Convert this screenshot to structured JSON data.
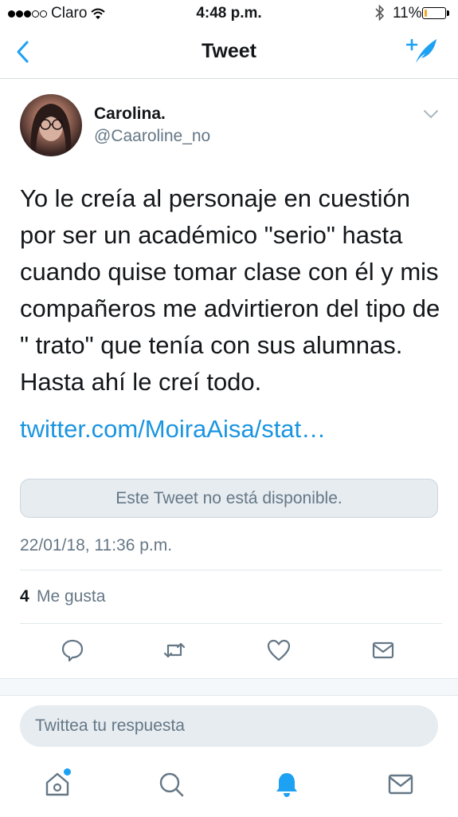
{
  "status_bar": {
    "carrier": "Claro",
    "time": "4:48 p.m.",
    "battery": "11%",
    "battery_level": 0.11,
    "icons": [
      "signal-dots-icon",
      "wifi-icon",
      "bluetooth-icon",
      "battery-icon"
    ]
  },
  "nav": {
    "title": "Tweet",
    "back_icon": "chevron-left-icon",
    "compose_icon": "compose-tweet-icon"
  },
  "tweet": {
    "display_name": "Carolina.",
    "handle": "@Caaroline_no",
    "text": "Yo le creía al personaje en cuestión por ser un académico \"serio\" hasta cuando quise tomar clase con él y mis compañeros me advirtieron del tipo de \" trato\" que tenía con sus alumnas. Hasta ahí le creí todo.",
    "link": "twitter.com/MoiraAisa/stat…",
    "quoted_unavailable": "Este Tweet no está disponible.",
    "timestamp": "22/01/18, 11:36 p.m.",
    "likes_count": "4",
    "likes_label": "Me gusta"
  },
  "actions": [
    "reply-icon",
    "retweet-icon",
    "like-icon",
    "direct-message-icon"
  ],
  "reply": {
    "placeholder": "Twittea tu respuesta"
  },
  "tab_bar": [
    "home-icon",
    "search-icon",
    "notifications-icon",
    "messages-icon"
  ],
  "colors": {
    "accent": "#1da1f2",
    "link": "#1b95e0",
    "secondary_text": "#657786"
  }
}
